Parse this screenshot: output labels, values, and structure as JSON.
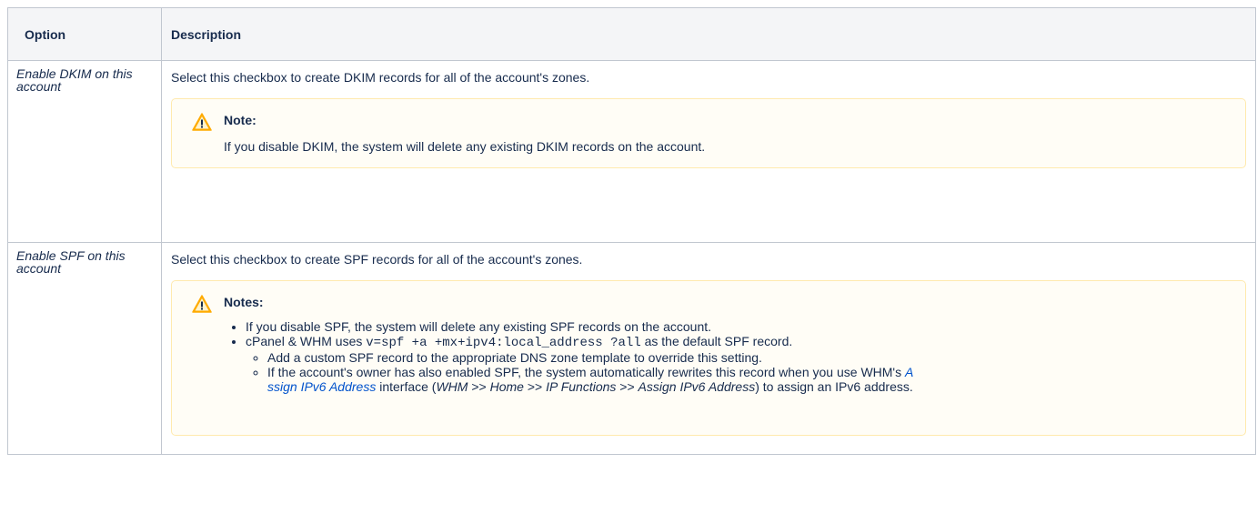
{
  "header": {
    "option": "Option",
    "description": "Description"
  },
  "rows": [
    {
      "option": "Enable DKIM on this account",
      "description": "Select this checkbox to create DKIM records for all of the account's zones.",
      "note": {
        "icon": "warning-icon",
        "title": "Note:",
        "text": "If you disable DKIM, the system will delete any existing DKIM records on the account."
      }
    },
    {
      "option": "Enable SPF on this account",
      "description": "Select this checkbox to create SPF records for all of the account's zones.",
      "note": {
        "icon": "warning-icon",
        "title": "Notes:",
        "bullet1": "If you disable SPF, the system will delete any existing SPF records on the account.",
        "bullet2_pre": "cPanel & WHM uses ",
        "bullet2_code": "v=spf +a +mx+ipv4:local_address ?all",
        "bullet2_post": " as the default SPF record.",
        "sub1": "Add a custom SPF record to the appropriate DNS zone template to override this setting.",
        "sub2_pre": "If the account's owner has also enabled SPF, the system automatically rewrites this record when you use WHM's ",
        "sub2_link1": "A",
        "sub2_link2": "ssign IPv6 Address",
        "sub2_mid": " interface (",
        "sub2_path_1": "WHM",
        "sub2_sep_1": " >> ",
        "sub2_path_2": "Home",
        "sub2_sep_2": " >> ",
        "sub2_path_3": "IP Functions",
        "sub2_sep_3": " >> ",
        "sub2_path_4": "Assign IPv6 Address",
        "sub2_post": ") to assign an IPv6 address."
      }
    }
  ]
}
